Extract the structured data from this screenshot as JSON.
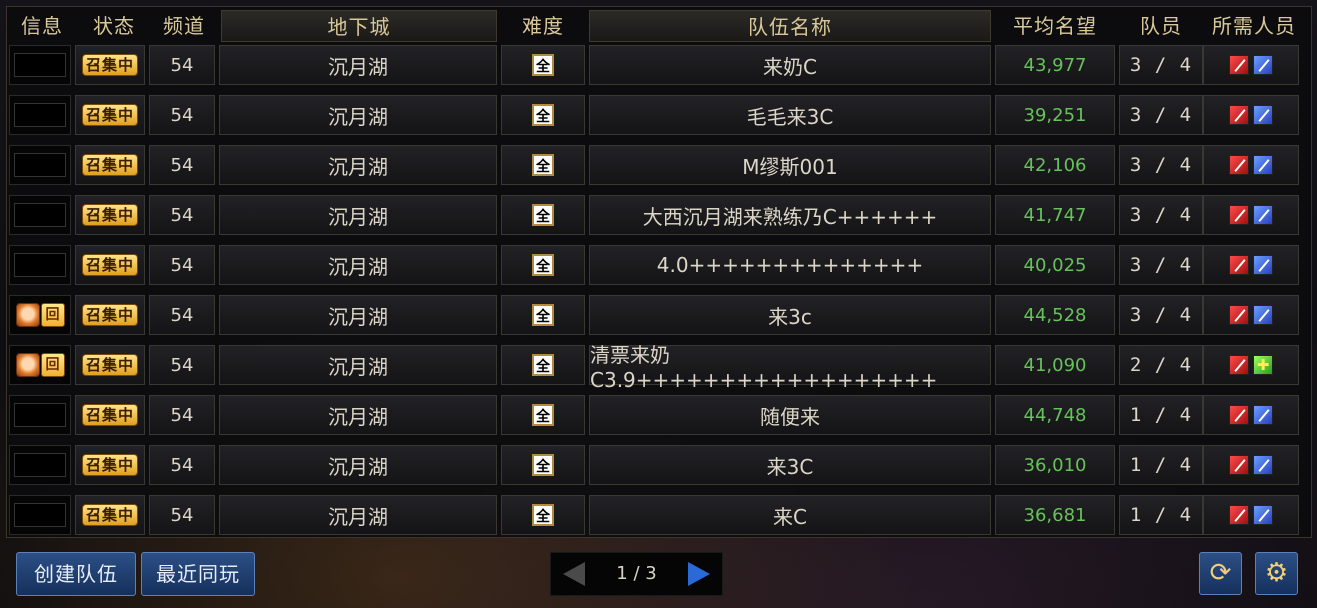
{
  "header": {
    "info": "信息",
    "status": "状态",
    "channel": "频道",
    "dungeon": "地下城",
    "difficulty": "难度",
    "team_name": "队伍名称",
    "avg_fame": "平均名望",
    "members": "队员",
    "required": "所需人员"
  },
  "rows": [
    {
      "status": "召集中",
      "channel": "54",
      "dungeon": "沉月湖",
      "difficulty": "全",
      "name": "来奶C",
      "fame": "43,977",
      "members": "3 / 4",
      "returning": false,
      "roles": [
        "red",
        "blue"
      ]
    },
    {
      "status": "召集中",
      "channel": "54",
      "dungeon": "沉月湖",
      "difficulty": "全",
      "name": "毛毛来3C",
      "fame": "39,251",
      "members": "3 / 4",
      "returning": false,
      "roles": [
        "red",
        "blue"
      ]
    },
    {
      "status": "召集中",
      "channel": "54",
      "dungeon": "沉月湖",
      "difficulty": "全",
      "name": "M缪斯001",
      "fame": "42,106",
      "members": "3 / 4",
      "returning": false,
      "roles": [
        "red",
        "blue"
      ]
    },
    {
      "status": "召集中",
      "channel": "54",
      "dungeon": "沉月湖",
      "difficulty": "全",
      "name": "大西沉月湖来熟练乃C++++++",
      "fame": "41,747",
      "members": "3 / 4",
      "returning": false,
      "roles": [
        "red",
        "blue"
      ]
    },
    {
      "status": "召集中",
      "channel": "54",
      "dungeon": "沉月湖",
      "difficulty": "全",
      "name": "4.0++++++++++++++",
      "fame": "40,025",
      "members": "3 / 4",
      "returning": false,
      "roles": [
        "red",
        "blue"
      ]
    },
    {
      "status": "召集中",
      "channel": "54",
      "dungeon": "沉月湖",
      "difficulty": "全",
      "name": "来3c",
      "fame": "44,528",
      "members": "3 / 4",
      "returning": true,
      "roles": [
        "red",
        "blue"
      ]
    },
    {
      "status": "召集中",
      "channel": "54",
      "dungeon": "沉月湖",
      "difficulty": "全",
      "name": "清票来奶C3.9++++++++++++++++++",
      "fame": "41,090",
      "members": "2 / 4",
      "returning": true,
      "roles": [
        "red",
        "green"
      ]
    },
    {
      "status": "召集中",
      "channel": "54",
      "dungeon": "沉月湖",
      "difficulty": "全",
      "name": "随便来",
      "fame": "44,748",
      "members": "1 / 4",
      "returning": false,
      "roles": [
        "red",
        "blue"
      ]
    },
    {
      "status": "召集中",
      "channel": "54",
      "dungeon": "沉月湖",
      "difficulty": "全",
      "name": "来3C",
      "fame": "36,010",
      "members": "1 / 4",
      "returning": false,
      "roles": [
        "red",
        "blue"
      ]
    },
    {
      "status": "召集中",
      "channel": "54",
      "dungeon": "沉月湖",
      "difficulty": "全",
      "name": "来C",
      "fame": "36,681",
      "members": "1 / 4",
      "returning": false,
      "roles": [
        "red",
        "blue"
      ]
    }
  ],
  "returning_badge": "回",
  "footer": {
    "create_team": "创建队伍",
    "recent_played": "最近同玩",
    "page": "1 / 3",
    "refresh_icon": "refresh-icon",
    "settings_icon": "gear-icon"
  },
  "colors": {
    "fame": "#66c25a",
    "button_bg": "#2c4f86",
    "status_badge": "#e0a020"
  }
}
